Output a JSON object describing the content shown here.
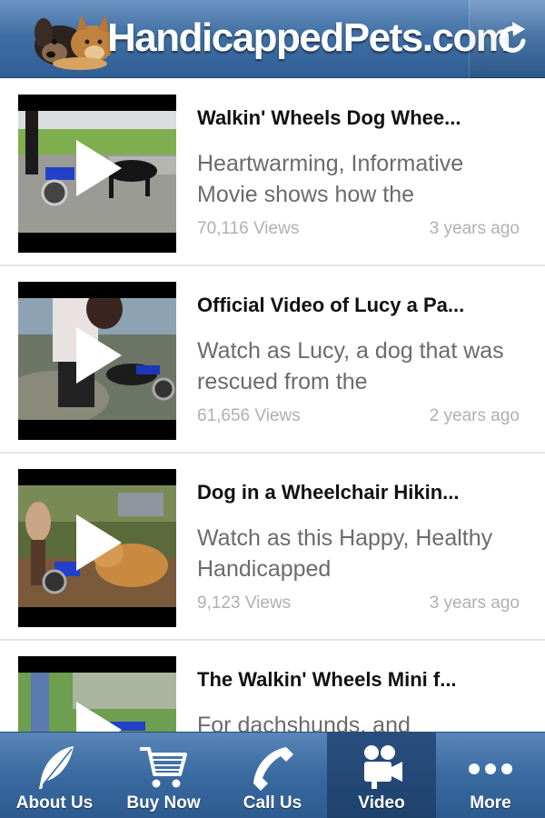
{
  "header": {
    "title": "HandicappedPets.com",
    "refresh_icon": "refresh-icon",
    "logo": "pets-logo"
  },
  "videos": [
    {
      "title": "Walkin' Wheels Dog Whee...",
      "description": "Heartwarming, Informative Movie shows how the",
      "views": "70,116 Views",
      "age": "3 years ago"
    },
    {
      "title": "Official Video of Lucy a Pa...",
      "description": "Watch as Lucy, a dog that was rescued from the",
      "views": "61,656 Views",
      "age": "2 years ago"
    },
    {
      "title": "Dog in a Wheelchair Hikin...",
      "description": "Watch as this Happy, Healthy Handicapped",
      "views": "9,123 Views",
      "age": "3 years ago"
    },
    {
      "title": "The Walkin' Wheels Mini f...",
      "description": "For dachshunds, and",
      "views": "",
      "age": ""
    }
  ],
  "tabs": [
    {
      "label": "About Us",
      "icon": "feather-icon",
      "active": false
    },
    {
      "label": "Buy Now",
      "icon": "cart-icon",
      "active": false
    },
    {
      "label": "Call Us",
      "icon": "phone-icon",
      "active": false
    },
    {
      "label": "Video",
      "icon": "video-camera-icon",
      "active": true
    },
    {
      "label": "More",
      "icon": "more-icon",
      "active": false
    }
  ],
  "colors": {
    "header_blue": "#3f6fa4",
    "tab_active": "#1f426d",
    "title_text": "#111111",
    "desc_text": "#6b6b6b",
    "meta_text": "#b0b0b0"
  }
}
